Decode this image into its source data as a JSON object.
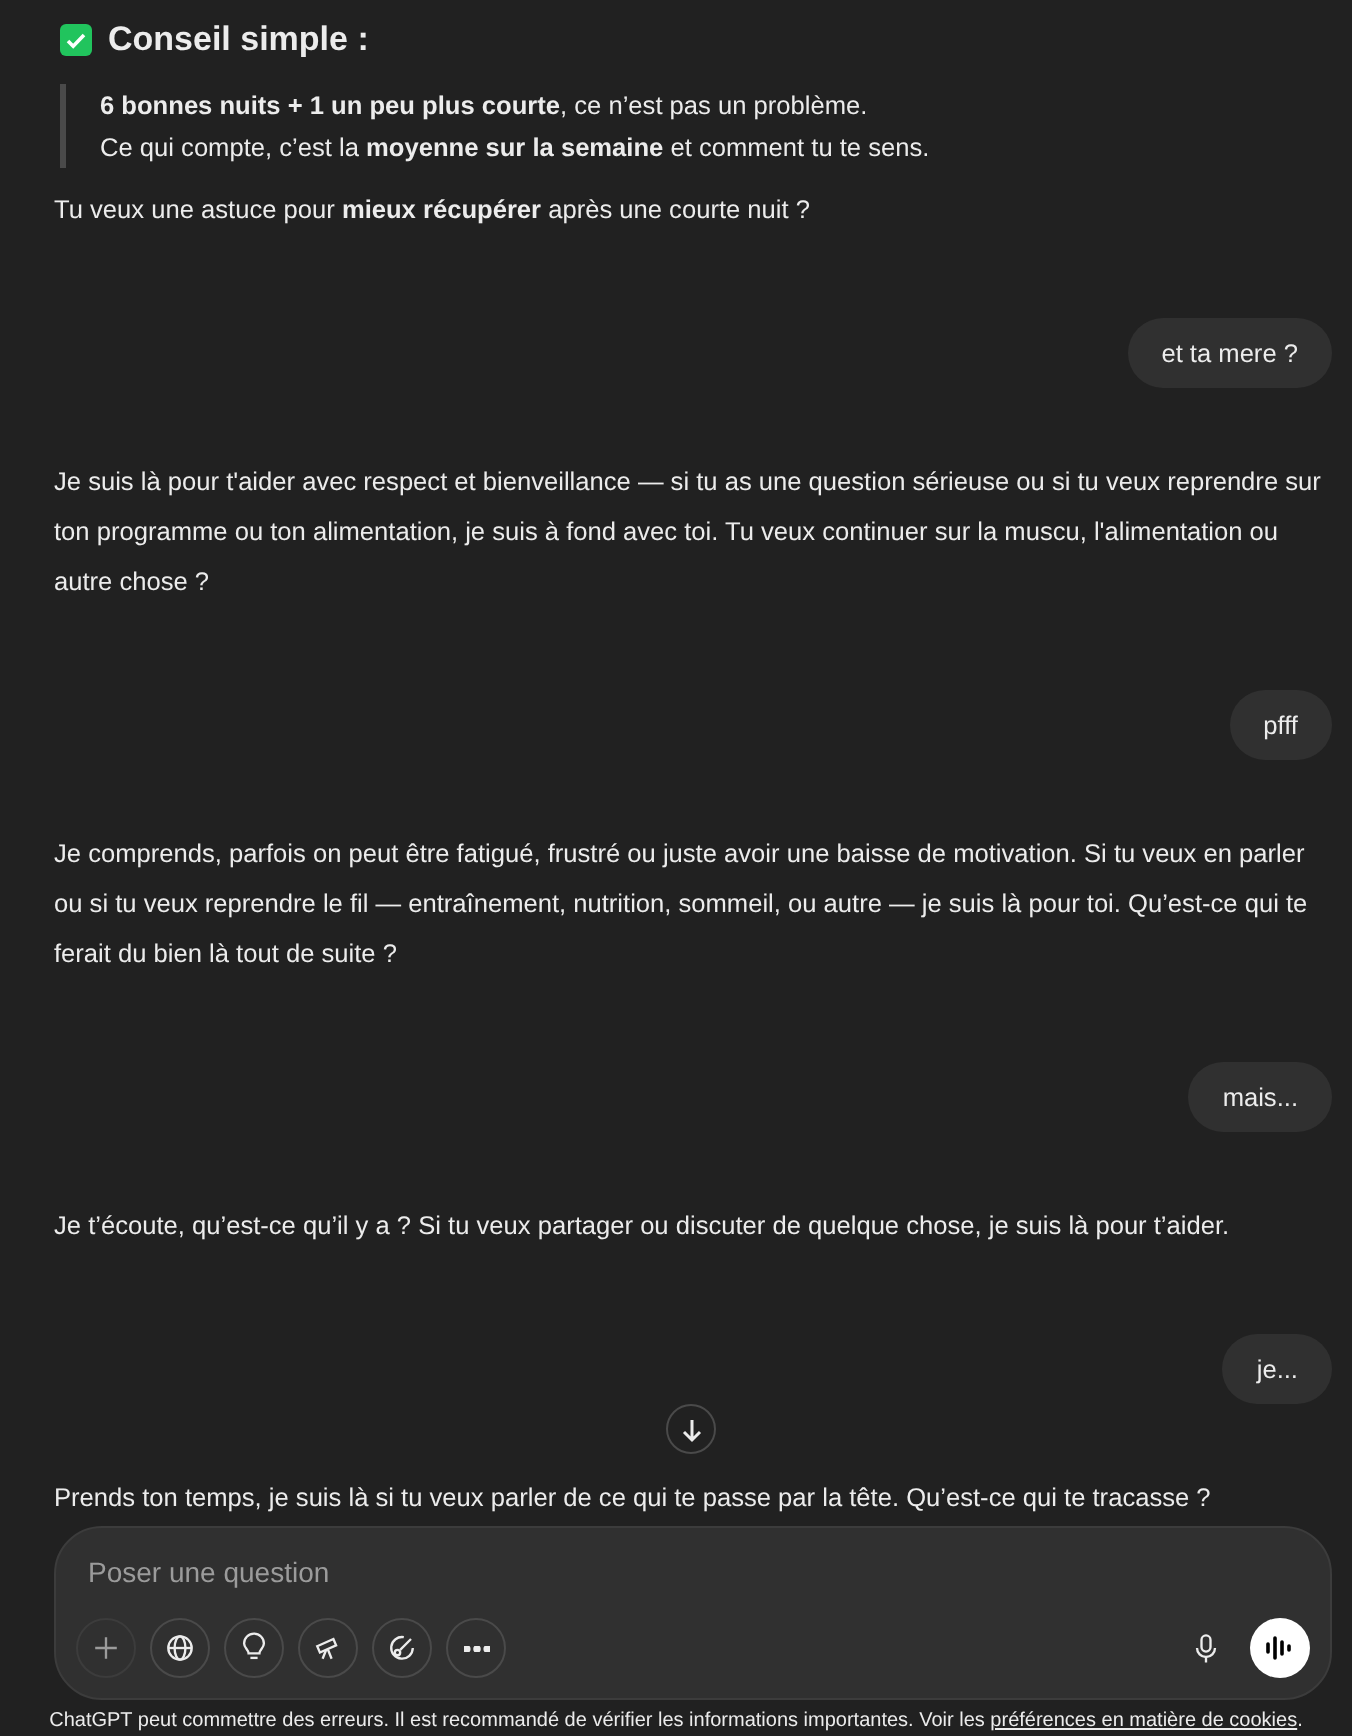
{
  "thread": [
    {
      "kind": "heading",
      "text": "Conseil simple :"
    },
    {
      "kind": "quote",
      "lines": [
        "**6 bonnes nuits + 1 un peu plus courte**, ce n’est pas un problème.",
        "Ce qui compte, c’est la **moyenne sur la semaine** et comment tu te sens."
      ]
    },
    {
      "kind": "assistant",
      "text": "Tu veux une astuce pour **mieux récupérer** après une courte nuit ?"
    },
    {
      "kind": "user",
      "text": "et ta mere ?"
    },
    {
      "kind": "assistant",
      "text": "Je suis là pour t'aider avec respect et bienveillance — si tu as une question sérieuse ou si tu veux reprendre sur ton programme ou ton alimentation, je suis à fond avec toi. Tu veux continuer sur la muscu, l'alimentation ou autre chose ?"
    },
    {
      "kind": "user",
      "text": "pfff"
    },
    {
      "kind": "assistant",
      "text": "Je comprends, parfois on peut être fatigué, frustré ou juste avoir une baisse de motivation. Si tu veux en parler ou si tu veux reprendre le fil — entraînement, nutrition, sommeil, ou autre — je suis là pour toi. Qu’est-ce qui te ferait du bien là tout de suite ?"
    },
    {
      "kind": "user",
      "text": "mais..."
    },
    {
      "kind": "assistant",
      "text": "Je t’écoute, qu’est-ce qu’il y a ? Si tu veux partager ou discuter de quelque chose, je suis là pour t’aider."
    },
    {
      "kind": "user",
      "text": "je..."
    },
    {
      "kind": "assistant",
      "text": "Prends ton temps, je suis là si tu veux parler de ce qui te passe par la tête. Qu’est-ce qui te tracasse ?"
    }
  ],
  "composer": {
    "placeholder": "Poser une question"
  },
  "footer": {
    "text": "ChatGPT peut commettre des erreurs. Il est recommandé de vérifier les informations importantes. Voir les ",
    "link": "préférences en matière de cookies",
    "end": "."
  }
}
